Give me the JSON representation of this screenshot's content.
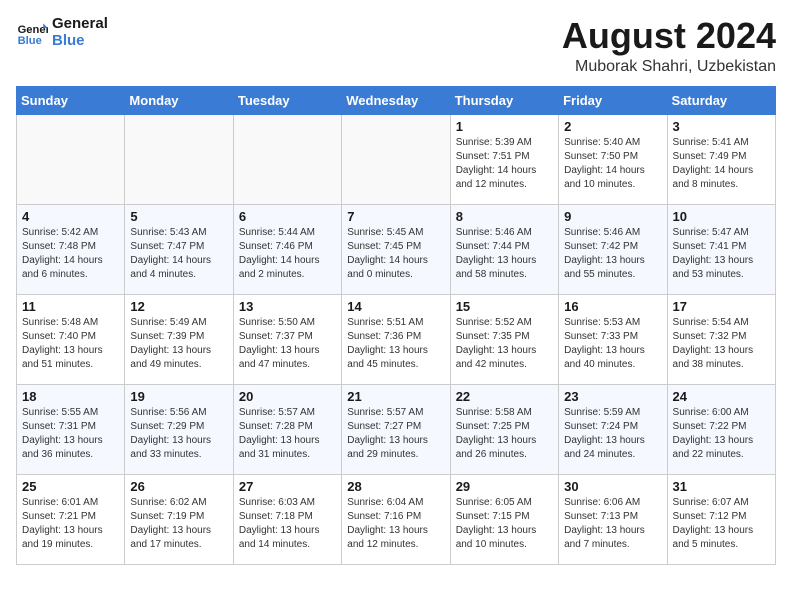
{
  "header": {
    "logo_line1": "General",
    "logo_line2": "Blue",
    "month_title": "August 2024",
    "location": "Muborak Shahri, Uzbekistan"
  },
  "weekdays": [
    "Sunday",
    "Monday",
    "Tuesday",
    "Wednesday",
    "Thursday",
    "Friday",
    "Saturday"
  ],
  "weeks": [
    [
      {
        "day": "",
        "sunrise": "",
        "sunset": "",
        "daylight": ""
      },
      {
        "day": "",
        "sunrise": "",
        "sunset": "",
        "daylight": ""
      },
      {
        "day": "",
        "sunrise": "",
        "sunset": "",
        "daylight": ""
      },
      {
        "day": "",
        "sunrise": "",
        "sunset": "",
        "daylight": ""
      },
      {
        "day": "1",
        "sunrise": "Sunrise: 5:39 AM",
        "sunset": "Sunset: 7:51 PM",
        "daylight": "Daylight: 14 hours and 12 minutes."
      },
      {
        "day": "2",
        "sunrise": "Sunrise: 5:40 AM",
        "sunset": "Sunset: 7:50 PM",
        "daylight": "Daylight: 14 hours and 10 minutes."
      },
      {
        "day": "3",
        "sunrise": "Sunrise: 5:41 AM",
        "sunset": "Sunset: 7:49 PM",
        "daylight": "Daylight: 14 hours and 8 minutes."
      }
    ],
    [
      {
        "day": "4",
        "sunrise": "Sunrise: 5:42 AM",
        "sunset": "Sunset: 7:48 PM",
        "daylight": "Daylight: 14 hours and 6 minutes."
      },
      {
        "day": "5",
        "sunrise": "Sunrise: 5:43 AM",
        "sunset": "Sunset: 7:47 PM",
        "daylight": "Daylight: 14 hours and 4 minutes."
      },
      {
        "day": "6",
        "sunrise": "Sunrise: 5:44 AM",
        "sunset": "Sunset: 7:46 PM",
        "daylight": "Daylight: 14 hours and 2 minutes."
      },
      {
        "day": "7",
        "sunrise": "Sunrise: 5:45 AM",
        "sunset": "Sunset: 7:45 PM",
        "daylight": "Daylight: 14 hours and 0 minutes."
      },
      {
        "day": "8",
        "sunrise": "Sunrise: 5:46 AM",
        "sunset": "Sunset: 7:44 PM",
        "daylight": "Daylight: 13 hours and 58 minutes."
      },
      {
        "day": "9",
        "sunrise": "Sunrise: 5:46 AM",
        "sunset": "Sunset: 7:42 PM",
        "daylight": "Daylight: 13 hours and 55 minutes."
      },
      {
        "day": "10",
        "sunrise": "Sunrise: 5:47 AM",
        "sunset": "Sunset: 7:41 PM",
        "daylight": "Daylight: 13 hours and 53 minutes."
      }
    ],
    [
      {
        "day": "11",
        "sunrise": "Sunrise: 5:48 AM",
        "sunset": "Sunset: 7:40 PM",
        "daylight": "Daylight: 13 hours and 51 minutes."
      },
      {
        "day": "12",
        "sunrise": "Sunrise: 5:49 AM",
        "sunset": "Sunset: 7:39 PM",
        "daylight": "Daylight: 13 hours and 49 minutes."
      },
      {
        "day": "13",
        "sunrise": "Sunrise: 5:50 AM",
        "sunset": "Sunset: 7:37 PM",
        "daylight": "Daylight: 13 hours and 47 minutes."
      },
      {
        "day": "14",
        "sunrise": "Sunrise: 5:51 AM",
        "sunset": "Sunset: 7:36 PM",
        "daylight": "Daylight: 13 hours and 45 minutes."
      },
      {
        "day": "15",
        "sunrise": "Sunrise: 5:52 AM",
        "sunset": "Sunset: 7:35 PM",
        "daylight": "Daylight: 13 hours and 42 minutes."
      },
      {
        "day": "16",
        "sunrise": "Sunrise: 5:53 AM",
        "sunset": "Sunset: 7:33 PM",
        "daylight": "Daylight: 13 hours and 40 minutes."
      },
      {
        "day": "17",
        "sunrise": "Sunrise: 5:54 AM",
        "sunset": "Sunset: 7:32 PM",
        "daylight": "Daylight: 13 hours and 38 minutes."
      }
    ],
    [
      {
        "day": "18",
        "sunrise": "Sunrise: 5:55 AM",
        "sunset": "Sunset: 7:31 PM",
        "daylight": "Daylight: 13 hours and 36 minutes."
      },
      {
        "day": "19",
        "sunrise": "Sunrise: 5:56 AM",
        "sunset": "Sunset: 7:29 PM",
        "daylight": "Daylight: 13 hours and 33 minutes."
      },
      {
        "day": "20",
        "sunrise": "Sunrise: 5:57 AM",
        "sunset": "Sunset: 7:28 PM",
        "daylight": "Daylight: 13 hours and 31 minutes."
      },
      {
        "day": "21",
        "sunrise": "Sunrise: 5:57 AM",
        "sunset": "Sunset: 7:27 PM",
        "daylight": "Daylight: 13 hours and 29 minutes."
      },
      {
        "day": "22",
        "sunrise": "Sunrise: 5:58 AM",
        "sunset": "Sunset: 7:25 PM",
        "daylight": "Daylight: 13 hours and 26 minutes."
      },
      {
        "day": "23",
        "sunrise": "Sunrise: 5:59 AM",
        "sunset": "Sunset: 7:24 PM",
        "daylight": "Daylight: 13 hours and 24 minutes."
      },
      {
        "day": "24",
        "sunrise": "Sunrise: 6:00 AM",
        "sunset": "Sunset: 7:22 PM",
        "daylight": "Daylight: 13 hours and 22 minutes."
      }
    ],
    [
      {
        "day": "25",
        "sunrise": "Sunrise: 6:01 AM",
        "sunset": "Sunset: 7:21 PM",
        "daylight": "Daylight: 13 hours and 19 minutes."
      },
      {
        "day": "26",
        "sunrise": "Sunrise: 6:02 AM",
        "sunset": "Sunset: 7:19 PM",
        "daylight": "Daylight: 13 hours and 17 minutes."
      },
      {
        "day": "27",
        "sunrise": "Sunrise: 6:03 AM",
        "sunset": "Sunset: 7:18 PM",
        "daylight": "Daylight: 13 hours and 14 minutes."
      },
      {
        "day": "28",
        "sunrise": "Sunrise: 6:04 AM",
        "sunset": "Sunset: 7:16 PM",
        "daylight": "Daylight: 13 hours and 12 minutes."
      },
      {
        "day": "29",
        "sunrise": "Sunrise: 6:05 AM",
        "sunset": "Sunset: 7:15 PM",
        "daylight": "Daylight: 13 hours and 10 minutes."
      },
      {
        "day": "30",
        "sunrise": "Sunrise: 6:06 AM",
        "sunset": "Sunset: 7:13 PM",
        "daylight": "Daylight: 13 hours and 7 minutes."
      },
      {
        "day": "31",
        "sunrise": "Sunrise: 6:07 AM",
        "sunset": "Sunset: 7:12 PM",
        "daylight": "Daylight: 13 hours and 5 minutes."
      }
    ]
  ]
}
